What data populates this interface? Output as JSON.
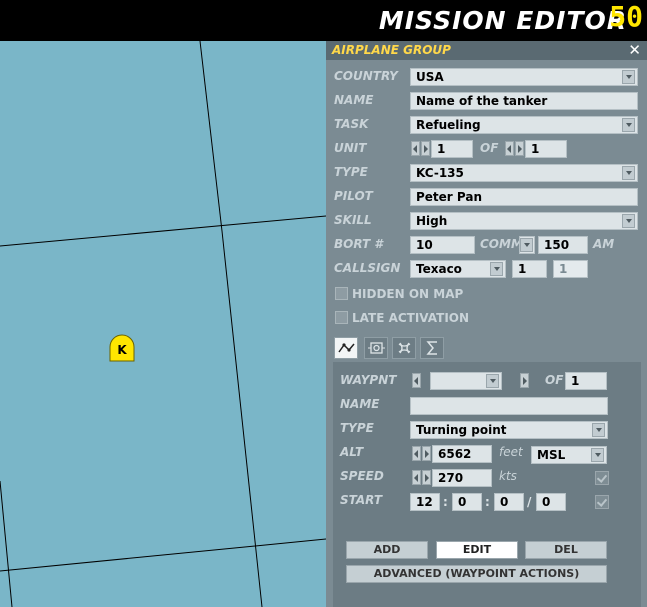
{
  "window": {
    "title": "MISSION EDITOR",
    "fps": "50"
  },
  "map": {
    "marker_label": "K",
    "marker_color": "#ffe600",
    "water_color": "#7ab6c8"
  },
  "panel": {
    "title": "AIRPLANE GROUP",
    "close_label": "✕",
    "country": {
      "label": "COUNTRY",
      "value": "USA"
    },
    "name": {
      "label": "NAME",
      "value": "Name of the tanker"
    },
    "task": {
      "label": "TASK",
      "value": "Refueling"
    },
    "unit": {
      "label": "UNIT",
      "value": "1",
      "of_label": "OF",
      "total": "1"
    },
    "type": {
      "label": "TYPE",
      "value": "KC-135"
    },
    "pilot": {
      "label": "PILOT",
      "value": "Peter Pan"
    },
    "skill": {
      "label": "SKILL",
      "value": "High"
    },
    "bort": {
      "label": "BORT #",
      "value": "10",
      "comm_label": "COMM",
      "comm_value": "150",
      "band": "AM"
    },
    "callsign": {
      "label": "CALLSIGN",
      "value": "Texaco",
      "num1": "1",
      "num2": "1"
    },
    "hidden_on_map": {
      "label": "HIDDEN ON MAP",
      "checked": false
    },
    "late_activation": {
      "label": "LATE ACTIVATION",
      "checked": false
    },
    "tabs": [
      {
        "icon": "route-icon",
        "active": true
      },
      {
        "icon": "target-icon",
        "active": false
      },
      {
        "icon": "payload-icon",
        "active": false
      },
      {
        "icon": "summary-icon",
        "active": false
      }
    ],
    "waypoint": {
      "waypnt_label": "WAYPNT",
      "waypnt_value": "",
      "of_label": "OF",
      "of_value": "1",
      "name_label": "NAME",
      "name_value": "",
      "type_label": "TYPE",
      "type_value": "Turning point",
      "alt_label": "ALT",
      "alt_value": "6562",
      "alt_unit": "feet",
      "alt_ref": "MSL",
      "speed_label": "SPEED",
      "speed_value": "270",
      "speed_unit": "kts",
      "start_label": "START",
      "start_h": "12",
      "start_m": "0",
      "start_s": "0",
      "start_day": "0",
      "sep_colon": ":",
      "sep_slash": "/"
    },
    "buttons": {
      "add": "ADD",
      "edit": "EDIT",
      "del": "DEL",
      "advanced": "ADVANCED (WAYPOINT ACTIONS)"
    }
  }
}
